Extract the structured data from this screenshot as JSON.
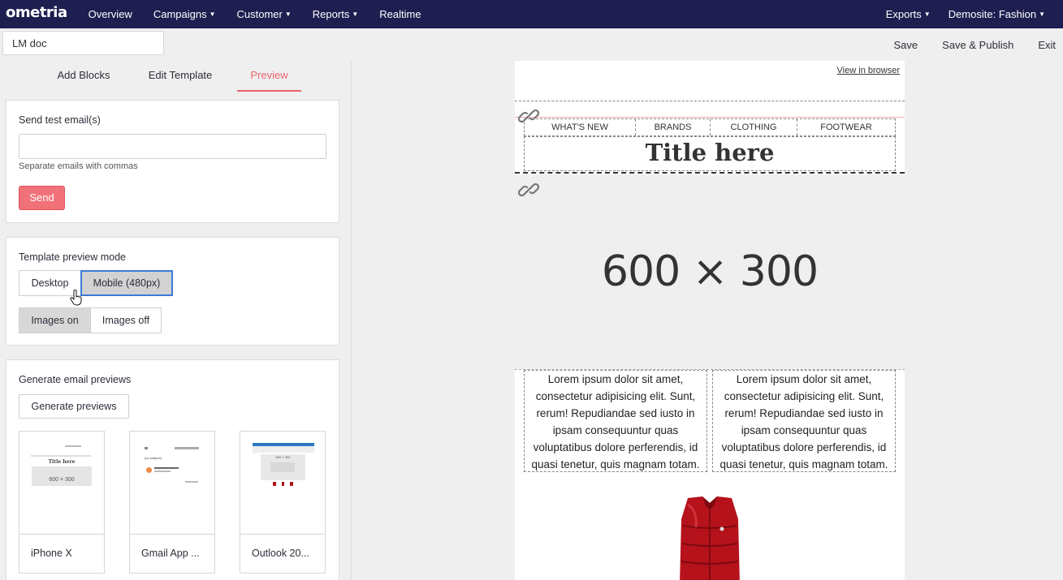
{
  "nav": {
    "logo": "ometria",
    "items": [
      "Overview",
      "Campaigns",
      "Customer",
      "Reports",
      "Realtime"
    ],
    "caret_items": [
      false,
      true,
      true,
      true,
      false
    ],
    "right": [
      "Exports",
      "Demosite: Fashion"
    ]
  },
  "toolbar": {
    "doc_name": "LM doc",
    "save": "Save",
    "save_publish": "Save & Publish",
    "exit": "Exit"
  },
  "tabs": [
    "Add Blocks",
    "Edit Template",
    "Preview"
  ],
  "active_tab": "Preview",
  "test_email": {
    "title": "Send test email(s)",
    "input_value": "",
    "hint": "Separate emails with commas",
    "send_label": "Send"
  },
  "preview_mode": {
    "title": "Template preview mode",
    "desktop": "Desktop",
    "mobile": "Mobile (480px)",
    "images_on": "Images on",
    "images_off": "Images off"
  },
  "previews": {
    "title": "Generate email previews",
    "button": "Generate previews",
    "thumbs": [
      {
        "caption": "iPhone X",
        "shot_title": "Title here",
        "shot_hero": "600 × 300"
      },
      {
        "caption": "Gmail App ...",
        "shot_title": "(no subject)"
      },
      {
        "caption": "Outlook 20...",
        "shot_hero": "600 × 300"
      }
    ]
  },
  "email": {
    "view_in_browser": "View in browser",
    "menu": [
      "WHAT'S NEW",
      "BRANDS",
      "CLOTHING",
      "FOOTWEAR"
    ],
    "title": "Title here",
    "hero": "600 × 300",
    "col_text": "Lorem ipsum dolor sit amet, consectetur adipisicing elit. Sunt, rerum! Repudiandae sed iusto in ipsam consequuntur quas voluptatibus dolore perferendis, id quasi tenetur, quis magnam totam.",
    "product_color": "#b5121b"
  },
  "colors": {
    "nav_bg": "#1e1e50",
    "accent": "#e9626b",
    "focus": "#3d7ad6"
  }
}
